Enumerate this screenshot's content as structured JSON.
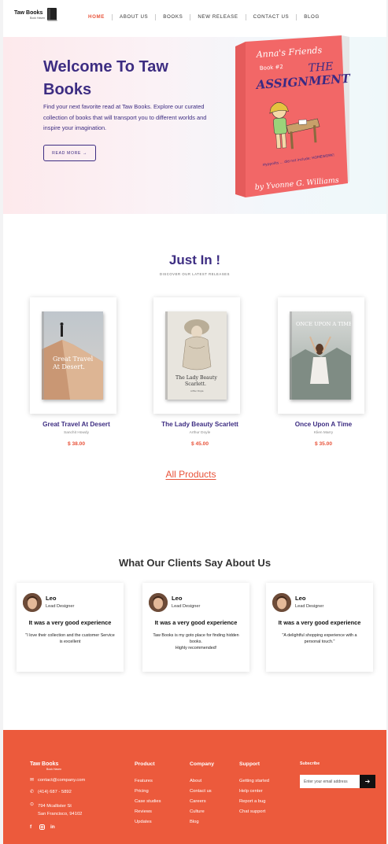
{
  "header": {
    "logo_name": "Taw Books",
    "logo_tagline": "Book Haven",
    "nav": [
      {
        "label": "HOME",
        "active": true
      },
      {
        "label": "ABOUT US"
      },
      {
        "label": "BOOKS"
      },
      {
        "label": "NEW RELEASE"
      },
      {
        "label": "CONTACT US"
      },
      {
        "label": "BLOG"
      }
    ]
  },
  "hero": {
    "title": "Welcome To Taw Books",
    "text": "Find your next favorite read at Taw Books. Explore our curated collection of books that will transport you to different worlds and inspire your imagination.",
    "button": "READ MORE →",
    "book": {
      "series": "Anna's Friends",
      "book_no": "Book #2",
      "title_top": "THE",
      "title_main": "ASSIGNMENT",
      "author": "by Yvonne G. Williams",
      "side_text": "Hyppolits ... did not include: HOMEWORK!"
    }
  },
  "just_in": {
    "title": "Just In !",
    "subtitle": "DISCOVER OUR LATEST RELEASES",
    "books": [
      {
        "title": "Great Travel At Desert",
        "author": "Sanchit Howdy",
        "price": "$ 38.00",
        "cover_text_1": "Great Travel",
        "cover_text_2": "At Desert."
      },
      {
        "title": "The Lady Beauty Scarlett",
        "author": "Arthur Doyle",
        "price": "$ 45.00",
        "cover_text_1": "The Lady Beauty",
        "cover_text_2": "Scarlett.",
        "cover_small": "Arthur Doyle"
      },
      {
        "title": "Once Upon A Time",
        "author": "Klien Marry",
        "price": "$ 35.00",
        "cover_text_1": "ONCE UPON A TIME"
      }
    ],
    "all_products": "All Products"
  },
  "testimonials": {
    "title": "What Our Clients Say About Us",
    "items": [
      {
        "name": "Leo",
        "role": "Lead Designer",
        "headline": "It was a very good experience",
        "quote": "\"I love their collection and the customer Service is excellent"
      },
      {
        "name": "Leo",
        "role": "Lead Designer",
        "headline": "It was a very good experience",
        "quote": "Taw Books is my goto place for finding hidden books.\nHighly recommended!"
      },
      {
        "name": "Leo",
        "role": "Lead Designer",
        "headline": "It was a very good experience",
        "quote": "\"A delightful shopping experience with a personal touch.\""
      }
    ]
  },
  "footer": {
    "brand": "Taw Books",
    "tagline": "Book Haven",
    "email": "contact@company.com",
    "phone": "(414) 687 - 5892",
    "address_1": "794 Mcallister St",
    "address_2": "San Francisco, 94102",
    "columns": [
      {
        "title": "Product",
        "links": [
          "Features",
          "Pricing",
          "Case studies",
          "Reviews",
          "Updates"
        ]
      },
      {
        "title": "Company",
        "links": [
          "About",
          "Contact us",
          "Careers",
          "Culture",
          "Blog"
        ]
      },
      {
        "title": "Support",
        "links": [
          "Getting started",
          "Help center",
          "Report a bug",
          "Chat support"
        ]
      }
    ],
    "subscribe_title": "Subscribe",
    "subscribe_placeholder": "Enter your email address",
    "subscribe_button_icon": "arrow-right-icon",
    "social": [
      "facebook-icon",
      "instagram-icon",
      "linkedin-icon"
    ]
  },
  "colors": {
    "accent": "#e8533a",
    "primary": "#3d2d82",
    "footer_bg": "#ec5a3c",
    "book_cover": "#f26767"
  }
}
